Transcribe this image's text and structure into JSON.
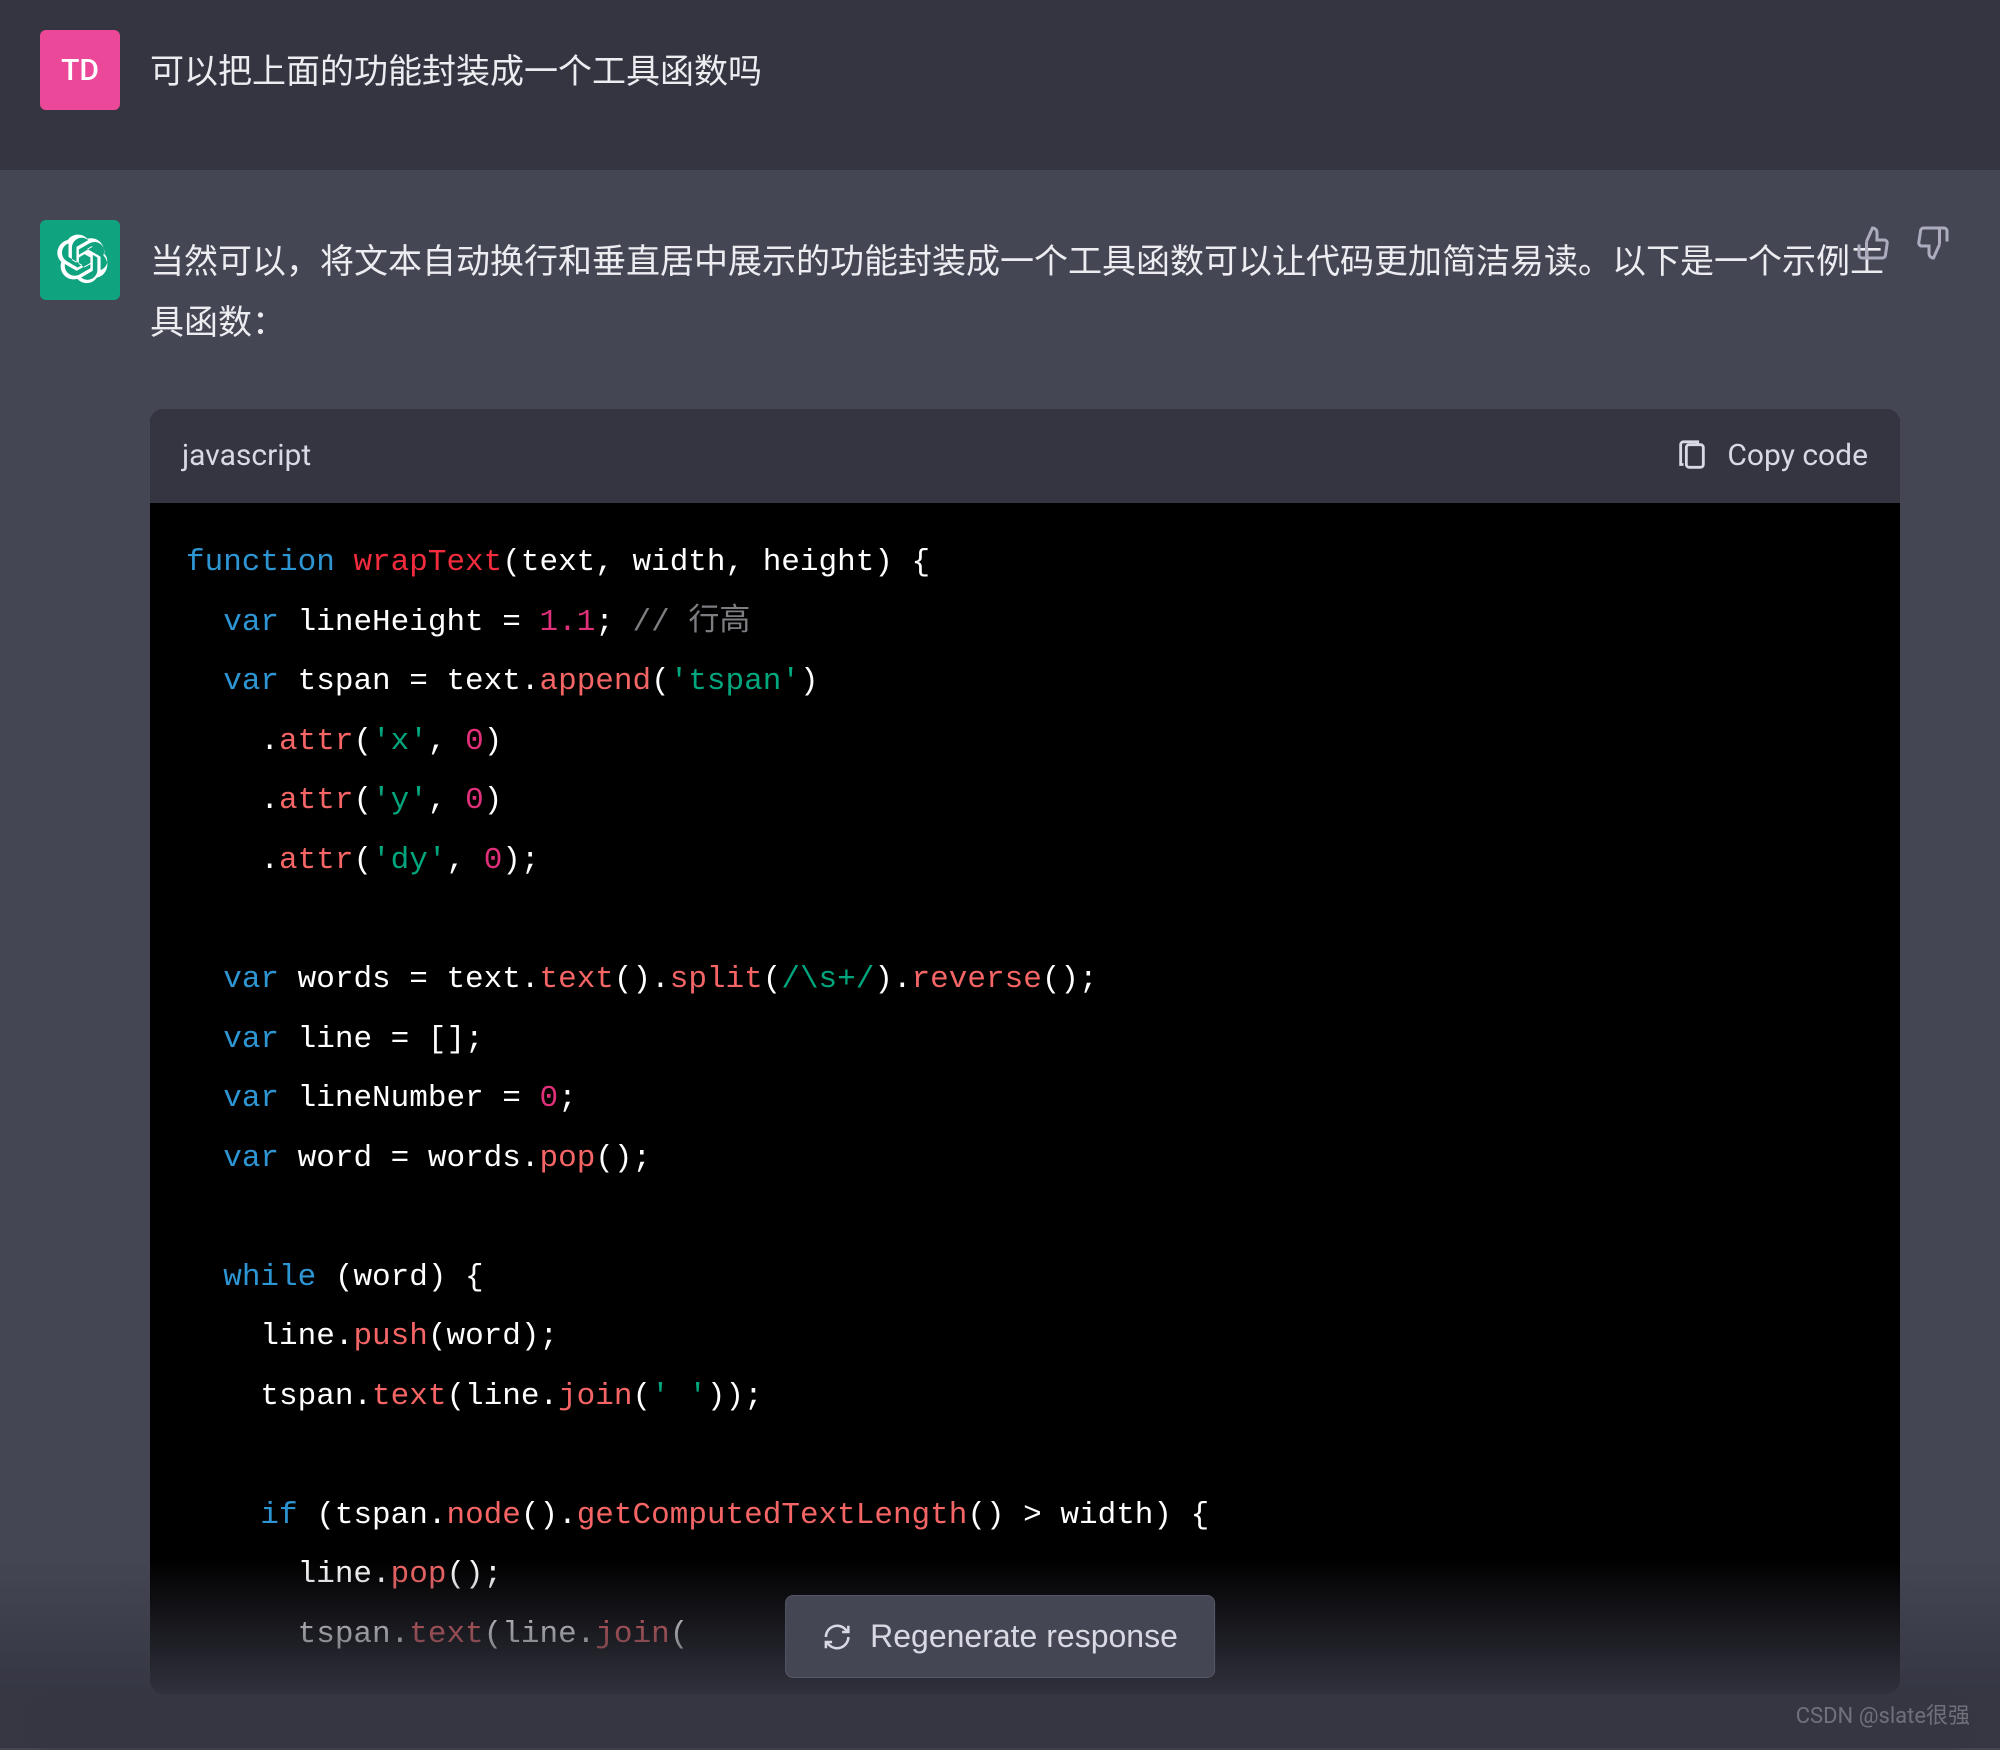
{
  "user": {
    "avatar_initials": "TD",
    "text": "可以把上面的功能封装成一个工具函数吗"
  },
  "assistant": {
    "intro": "当然可以，将文本自动换行和垂直居中展示的功能封装成一个工具函数可以让代码更加简洁易读。以下是一个示例工具函数："
  },
  "code_block": {
    "language": "javascript",
    "copy_label": "Copy code",
    "tokens": [
      [
        {
          "t": "function",
          "c": "tk-kw"
        },
        {
          "t": " "
        },
        {
          "t": "wrapText",
          "c": "tk-fn"
        },
        {
          "t": "(text, width, height) {"
        }
      ],
      [
        {
          "t": "  "
        },
        {
          "t": "var",
          "c": "tk-kw"
        },
        {
          "t": " lineHeight = "
        },
        {
          "t": "1.1",
          "c": "tk-num"
        },
        {
          "t": "; "
        },
        {
          "t": "// 行高",
          "c": "tk-cm"
        }
      ],
      [
        {
          "t": "  "
        },
        {
          "t": "var",
          "c": "tk-kw"
        },
        {
          "t": " tspan = text."
        },
        {
          "t": "append",
          "c": "tk-pr"
        },
        {
          "t": "("
        },
        {
          "t": "'tspan'",
          "c": "tk-str"
        },
        {
          "t": ")"
        }
      ],
      [
        {
          "t": "    ."
        },
        {
          "t": "attr",
          "c": "tk-pr"
        },
        {
          "t": "("
        },
        {
          "t": "'x'",
          "c": "tk-str"
        },
        {
          "t": ", "
        },
        {
          "t": "0",
          "c": "tk-num"
        },
        {
          "t": ")"
        }
      ],
      [
        {
          "t": "    ."
        },
        {
          "t": "attr",
          "c": "tk-pr"
        },
        {
          "t": "("
        },
        {
          "t": "'y'",
          "c": "tk-str"
        },
        {
          "t": ", "
        },
        {
          "t": "0",
          "c": "tk-num"
        },
        {
          "t": ")"
        }
      ],
      [
        {
          "t": "    ."
        },
        {
          "t": "attr",
          "c": "tk-pr"
        },
        {
          "t": "("
        },
        {
          "t": "'dy'",
          "c": "tk-str"
        },
        {
          "t": ", "
        },
        {
          "t": "0",
          "c": "tk-num"
        },
        {
          "t": ");"
        }
      ],
      [
        {
          "t": " "
        }
      ],
      [
        {
          "t": "  "
        },
        {
          "t": "var",
          "c": "tk-kw"
        },
        {
          "t": " words = text."
        },
        {
          "t": "text",
          "c": "tk-pr"
        },
        {
          "t": "()."
        },
        {
          "t": "split",
          "c": "tk-pr"
        },
        {
          "t": "("
        },
        {
          "t": "/\\s+/",
          "c": "tk-rx"
        },
        {
          "t": ")."
        },
        {
          "t": "reverse",
          "c": "tk-pr"
        },
        {
          "t": "();"
        }
      ],
      [
        {
          "t": "  "
        },
        {
          "t": "var",
          "c": "tk-kw"
        },
        {
          "t": " line = [];"
        }
      ],
      [
        {
          "t": "  "
        },
        {
          "t": "var",
          "c": "tk-kw"
        },
        {
          "t": " lineNumber = "
        },
        {
          "t": "0",
          "c": "tk-num"
        },
        {
          "t": ";"
        }
      ],
      [
        {
          "t": "  "
        },
        {
          "t": "var",
          "c": "tk-kw"
        },
        {
          "t": " word = words."
        },
        {
          "t": "pop",
          "c": "tk-pr"
        },
        {
          "t": "();"
        }
      ],
      [
        {
          "t": " "
        }
      ],
      [
        {
          "t": "  "
        },
        {
          "t": "while",
          "c": "tk-kw"
        },
        {
          "t": " (word) {"
        }
      ],
      [
        {
          "t": "    line."
        },
        {
          "t": "push",
          "c": "tk-pr"
        },
        {
          "t": "(word);"
        }
      ],
      [
        {
          "t": "    tspan."
        },
        {
          "t": "text",
          "c": "tk-pr"
        },
        {
          "t": "(line."
        },
        {
          "t": "join",
          "c": "tk-pr"
        },
        {
          "t": "("
        },
        {
          "t": "' '",
          "c": "tk-str"
        },
        {
          "t": "));"
        }
      ],
      [
        {
          "t": " "
        }
      ],
      [
        {
          "t": "    "
        },
        {
          "t": "if",
          "c": "tk-kw"
        },
        {
          "t": " (tspan."
        },
        {
          "t": "node",
          "c": "tk-pr"
        },
        {
          "t": "()."
        },
        {
          "t": "getComputedTextLength",
          "c": "tk-pr"
        },
        {
          "t": "() > width) {"
        }
      ],
      [
        {
          "t": "      line."
        },
        {
          "t": "pop",
          "c": "tk-pr"
        },
        {
          "t": "();"
        }
      ],
      [
        {
          "t": "      tspan."
        },
        {
          "t": "text",
          "c": "tk-pr"
        },
        {
          "t": "(line."
        },
        {
          "t": "join",
          "c": "tk-pr"
        },
        {
          "t": "("
        }
      ]
    ]
  },
  "regenerate_label": "Regenerate response",
  "watermark": "CSDN @slate很强"
}
